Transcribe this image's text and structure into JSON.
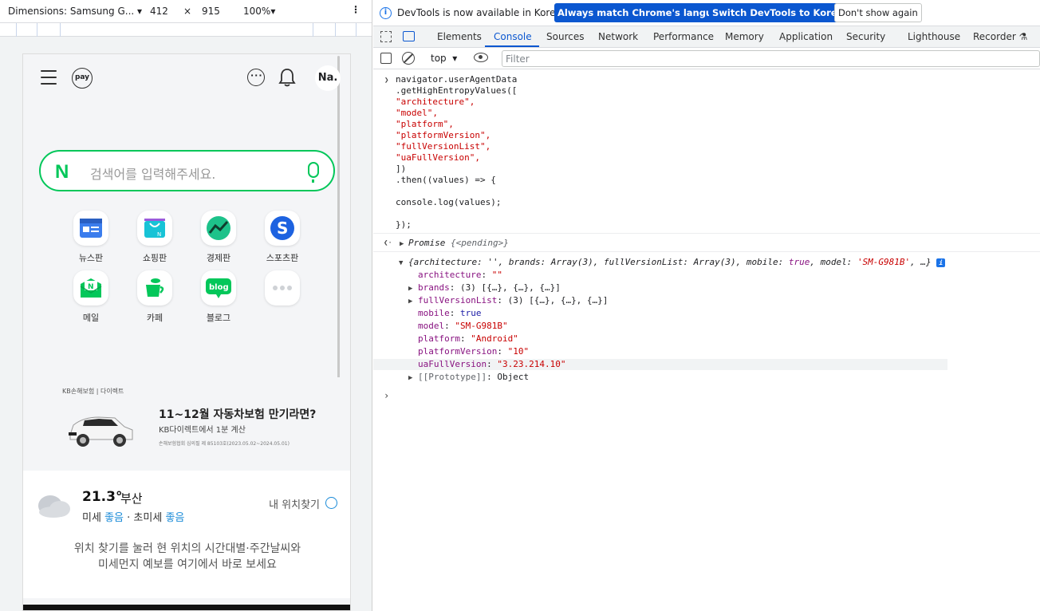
{
  "device_toolbar": {
    "device": "Dimensions: Samsung G...",
    "width": "412",
    "times": "×",
    "height": "915",
    "zoom": "100%",
    "more": "⋮"
  },
  "phone": {
    "pay_label": "pay",
    "avatar": "Na.",
    "search_logo": "N",
    "search_placeholder": "검색어를 입력해주세요.",
    "apps": [
      {
        "label": "뉴스판"
      },
      {
        "label": "쇼핑판"
      },
      {
        "label": "경제판"
      },
      {
        "label": "스포츠판"
      },
      {
        "label": "메일"
      },
      {
        "label": "카페"
      },
      {
        "label": "블로그"
      },
      {
        "label": ""
      }
    ],
    "shopping_badge": "N",
    "sports_badge": "S",
    "mail_badge": "N",
    "blog_badge": "blog",
    "ad": {
      "brand": "KB손해보험 | 다이렉트",
      "title": "11~12월 자동차보험 만기라면?",
      "subtitle": "KB다이렉트에서 1분 계산",
      "fineprint": "손해보험협회 심의필 제 85103호(2023.05.02~2024.05.01)"
    },
    "weather": {
      "temp": "21.3°",
      "city": "부산",
      "dust_label": "미세",
      "dust_value": "좋음",
      "sep": "·",
      "fine_dust_label": "초미세",
      "fine_dust_value": "좋음",
      "locate": "내 위치찾기",
      "message_1": "위치 찾기를 눌러 현 위치의 시간대별·주간날씨와",
      "message_2": "미세먼지 예보를 여기에서 바로 보세요"
    }
  },
  "devtools": {
    "info_icon": "i",
    "info_message": "DevTools is now available in Korean!",
    "btn_match": "Always match Chrome's language",
    "btn_switch": "Switch DevTools to Korean",
    "btn_dismiss": "Don't show again",
    "tabs": [
      "Elements",
      "Console",
      "Sources",
      "Network",
      "Performance",
      "Memory",
      "Application",
      "Security",
      "Lighthouse",
      "Recorder"
    ],
    "active_tab": "Console",
    "recorder_icon": "⚗",
    "context": "top",
    "filter_placeholder": "Filter",
    "input_lines": [
      "navigator.userAgentData",
      ".getHighEntropyValues([",
      "\"architecture\",",
      "\"model\",",
      "\"platform\",",
      "\"platformVersion\",",
      "\"fullVersionList\",",
      "\"uaFullVersion\",",
      "])",
      ".then((values) => {",
      "",
      "console.log(values);",
      "",
      "});"
    ],
    "promise_label": "Promise",
    "promise_state": "{<pending>}",
    "object_summary_prefix": "{architecture: '', brands: Array(3), fullVersionList: Array(3), mobile: ",
    "object_summary_true": "true",
    "object_summary_mid": ", model: ",
    "object_summary_model": "'SM-G981B'",
    "object_summary_suffix": ", …}",
    "props": {
      "architecture_key": "architecture",
      "architecture_val": "\"\"",
      "brands_key": "brands",
      "brands_val": "(3) [{…}, {…}, {…}]",
      "fvl_key": "fullVersionList",
      "fvl_val": "(3) [{…}, {…}, {…}]",
      "mobile_key": "mobile",
      "mobile_val": "true",
      "model_key": "model",
      "model_val": "\"SM-G981B\"",
      "platform_key": "platform",
      "platform_val": "\"Android\"",
      "pv_key": "platformVersion",
      "pv_val": "\"10\"",
      "ua_key": "uaFullVersion",
      "ua_val": "\"3.23.214.10\"",
      "proto_key": "[[Prototype]]",
      "proto_val": "Object"
    }
  }
}
